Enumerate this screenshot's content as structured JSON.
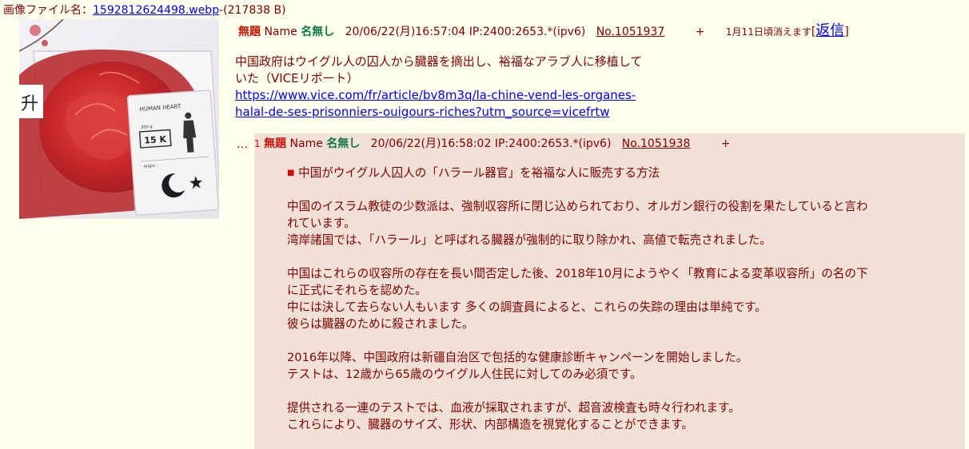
{
  "file": {
    "label": "画像ファイル名：",
    "name": "1592812624498.webp",
    "size": "-(217838 B)"
  },
  "thumbnail": {
    "badge_char": "升",
    "card_title": "HUMAN HEART",
    "card_weight": "300 g",
    "card_price": "15 K",
    "card_origin": "origin :"
  },
  "op": {
    "subject": "無題",
    "name_label": "Name",
    "name": "名無し",
    "datetime": "20/06/22(月)16:57:04",
    "ip": "IP:2400:2653.*(ipv6)",
    "number": "No.1051937",
    "plus": "+",
    "expiry": "1月11日頃消えます",
    "reply_label": "返信",
    "body_lines": [
      "中国政府はウイグル人の囚人から臓器を摘出し、裕福なアラブ人に移植して",
      "いた（VICEリポート）"
    ],
    "link_lines": [
      "https://www.vice.com/fr/article/bv8m3q/la-chine-vend-les-organes-",
      "halal-de-ses-prisonniers-ouigours-riches?utm_source=vicefrtw"
    ]
  },
  "reply": {
    "dots": "…",
    "index": "1",
    "subject": "無題",
    "name_label": "Name",
    "name": "名無し",
    "datetime": "20/06/22(月)16:58:02",
    "ip": "IP:2400:2653.*(ipv6)",
    "number": "No.1051938",
    "plus": "+",
    "bullet": "■",
    "heading": "中国がウイグル人囚人の「ハラール器官」を裕福な人に販売する方法",
    "lines": [
      "",
      "中国のイスラム教徒の少数派は、強制収容所に閉じ込められており、オルガン銀行の役割を果たしていると言わ",
      "れています。",
      "湾岸諸国では、「ハラール」と呼ばれる臓器が強制的に取り除かれ、高値で転売されました。",
      "",
      "中国はこれらの収容所の存在を長い間否定した後、2018年10月にようやく「教育による変革収容所」の名の下",
      "に正式にそれらを認めた。",
      "中には決して去らない人もいます 多くの調査員によると、これらの失踪の理由は単純です。",
      "彼らは臓器のために殺されました。",
      "",
      "2016年以降、中国政府は新疆自治区で包括的な健康診断キャンペーンを開始しました。",
      "テストは、12歳から65歳のウイグル人住民に対してのみ必須です。",
      "",
      "提供される一連のテストでは、血液が採取されますが、超音波検査も時々行われます。",
      "これらにより、臓器のサイズ、形状、内部構造を視覚化することができます。"
    ]
  }
}
